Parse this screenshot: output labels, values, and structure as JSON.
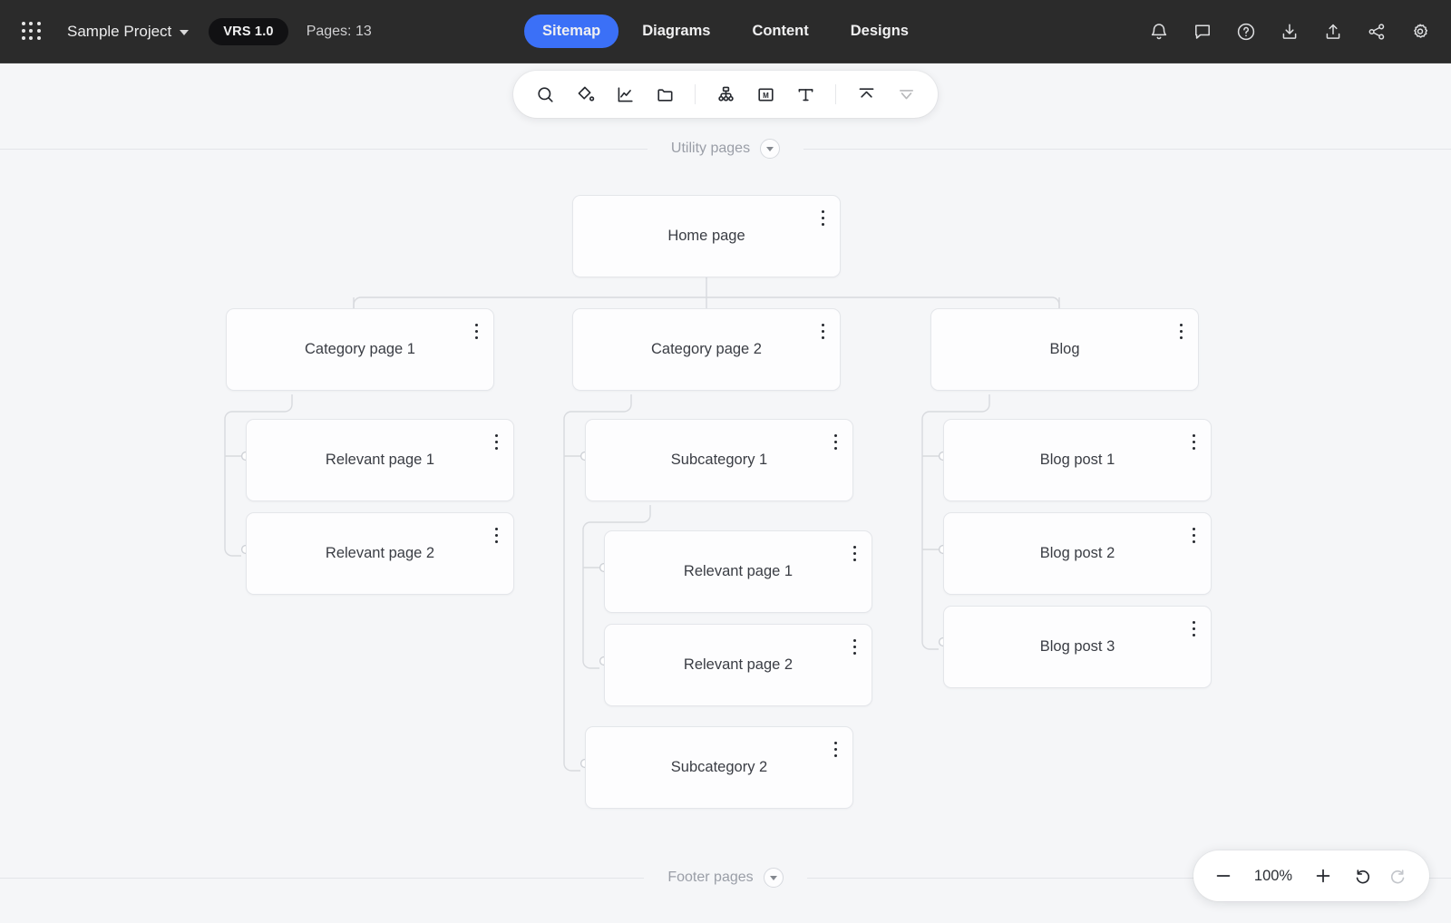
{
  "header": {
    "apps_icon": "grid-apps-icon",
    "project_name": "Sample Project",
    "project_chevron": "chevron-down-icon",
    "version_badge": "VRS 1.0",
    "pages_count": "Pages: 13",
    "tabs": [
      {
        "label": "Sitemap",
        "active": true
      },
      {
        "label": "Diagrams",
        "active": false
      },
      {
        "label": "Content",
        "active": false
      },
      {
        "label": "Designs",
        "active": false
      }
    ],
    "actions": [
      {
        "name": "notifications-icon"
      },
      {
        "name": "comments-icon"
      },
      {
        "name": "help-icon"
      },
      {
        "name": "download-icon"
      },
      {
        "name": "upload-icon"
      },
      {
        "name": "share-icon"
      },
      {
        "name": "settings-gear-icon"
      }
    ],
    "active_tab_color": "#3b70f7",
    "background_color": "#2b2b2b"
  },
  "toolbar": {
    "items": [
      {
        "name": "search-icon"
      },
      {
        "name": "fill-color-icon"
      },
      {
        "name": "analytics-icon"
      },
      {
        "name": "folder-icon"
      },
      {
        "name": "divider"
      },
      {
        "name": "sitemap-node-icon"
      },
      {
        "name": "markdown-icon",
        "glyph": "M"
      },
      {
        "name": "text-icon",
        "glyph": "T"
      },
      {
        "name": "divider"
      },
      {
        "name": "collapse-all-icon"
      },
      {
        "name": "expand-all-icon"
      }
    ]
  },
  "canvas": {
    "top_section": {
      "label": "Utility pages",
      "toggle": "chevron-down-icon"
    },
    "bottom_section": {
      "label": "Footer pages",
      "toggle": "chevron-down-icon"
    },
    "node_fill": "#fdfdfe",
    "node_border": "#e4e6ea",
    "edge_color": "#d8dade",
    "background_color": "#f5f6f8"
  },
  "sitemap": {
    "root": {
      "id": "home",
      "label": "Home page"
    },
    "nodes": [
      {
        "id": "home",
        "label": "Home page"
      },
      {
        "id": "cat1",
        "label": "Category page 1"
      },
      {
        "id": "cat2",
        "label": "Category page 2"
      },
      {
        "id": "blog",
        "label": "Blog"
      },
      {
        "id": "c1rel1",
        "label": "Relevant page 1"
      },
      {
        "id": "c1rel2",
        "label": "Relevant page 2"
      },
      {
        "id": "sub1",
        "label": "Subcategory 1"
      },
      {
        "id": "s1rel1",
        "label": "Relevant page 1"
      },
      {
        "id": "s1rel2",
        "label": "Relevant page 2"
      },
      {
        "id": "sub2",
        "label": "Subcategory 2"
      },
      {
        "id": "post1",
        "label": "Blog post 1"
      },
      {
        "id": "post2",
        "label": "Blog post 2"
      },
      {
        "id": "post3",
        "label": "Blog post 3"
      }
    ],
    "menu_icon": "kebab-menu-icon"
  },
  "zoom_controls": {
    "zoom_out": "minus-icon",
    "level": "100%",
    "zoom_in": "plus-icon",
    "undo": "undo-icon",
    "redo": "redo-icon"
  }
}
